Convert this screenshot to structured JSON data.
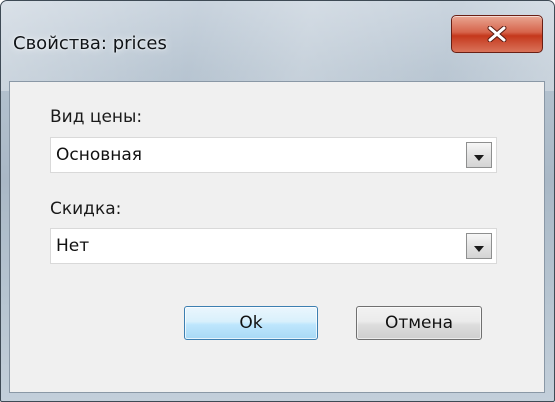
{
  "window": {
    "title": "Свойства: prices",
    "close_icon": "close-icon",
    "close_color": "#c5381c"
  },
  "fields": [
    {
      "label": "Вид цены:",
      "value": "Основная",
      "icon": "chevron-down-icon"
    },
    {
      "label": "Скидка:",
      "value": "Нет",
      "icon": "chevron-down-icon"
    }
  ],
  "buttons": {
    "ok_label": "Ok",
    "cancel_label": "Отмена"
  }
}
